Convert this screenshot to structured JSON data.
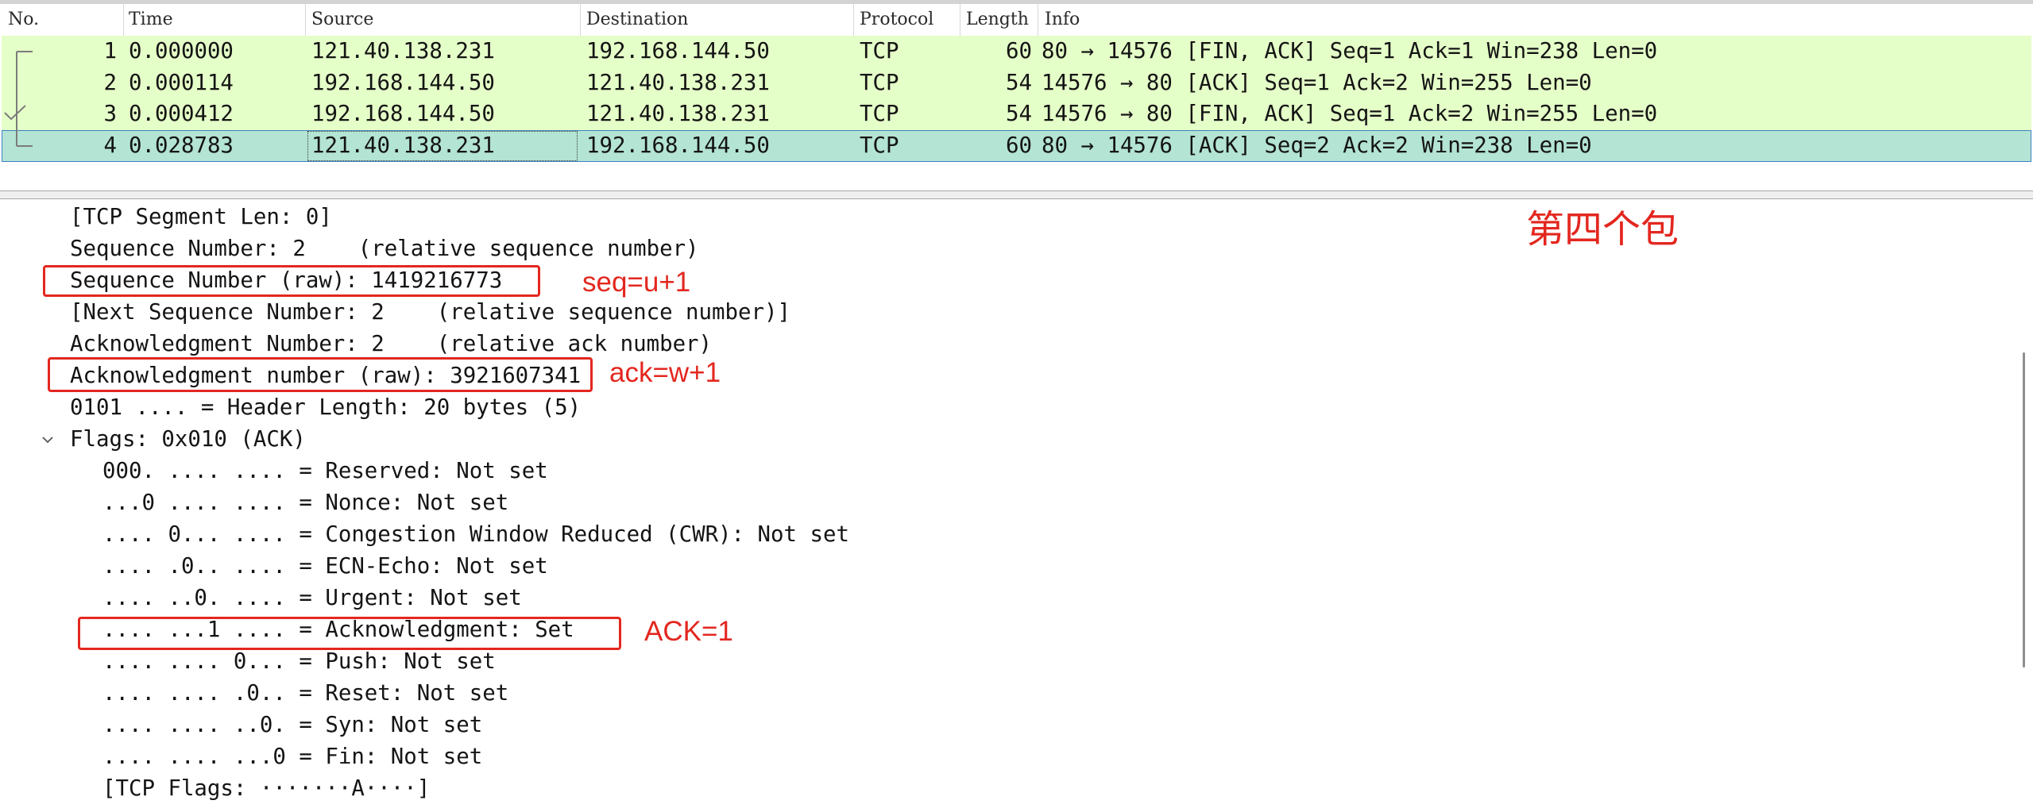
{
  "packet_list": {
    "columns": {
      "no": "No.",
      "time": "Time",
      "source": "Source",
      "destination": "Destination",
      "protocol": "Protocol",
      "length": "Length",
      "info": "Info"
    },
    "rows": [
      {
        "no": "1",
        "time": "0.000000",
        "source": "121.40.138.231",
        "destination": "192.168.144.50",
        "protocol": "TCP",
        "length": "60",
        "info": "80 → 14576 [FIN, ACK] Seq=1 Ack=1 Win=238 Len=0",
        "selected": false
      },
      {
        "no": "2",
        "time": "0.000114",
        "source": "192.168.144.50",
        "destination": "121.40.138.231",
        "protocol": "TCP",
        "length": "54",
        "info": "14576 → 80 [ACK] Seq=1 Ack=2 Win=255 Len=0",
        "selected": false
      },
      {
        "no": "3",
        "time": "0.000412",
        "source": "192.168.144.50",
        "destination": "121.40.138.231",
        "protocol": "TCP",
        "length": "54",
        "info": "14576 → 80 [FIN, ACK] Seq=1 Ack=2 Win=255 Len=0",
        "selected": false
      },
      {
        "no": "4",
        "time": "0.028783",
        "source": "121.40.138.231",
        "destination": "192.168.144.50",
        "protocol": "TCP",
        "length": "60",
        "info": "80 → 14576 [ACK] Seq=2 Ack=2 Win=238 Len=0",
        "selected": true
      }
    ]
  },
  "packet_details": {
    "lines": [
      "[TCP Segment Len: 0]",
      "Sequence Number: 2    (relative sequence number)",
      "Sequence Number (raw): 1419216773",
      "[Next Sequence Number: 2    (relative sequence number)]",
      "Acknowledgment Number: 2    (relative ack number)",
      "Acknowledgment number (raw): 3921607341",
      "0101 .... = Header Length: 20 bytes (5)",
      "Flags: 0x010 (ACK)",
      "000. .... .... = Reserved: Not set",
      "...0 .... .... = Nonce: Not set",
      ".... 0... .... = Congestion Window Reduced (CWR): Not set",
      ".... .0.. .... = ECN-Echo: Not set",
      ".... ..0. .... = Urgent: Not set",
      ".... ...1 .... = Acknowledgment: Set",
      ".... .... 0... = Push: Not set",
      ".... .... .0.. = Reset: Not set",
      ".... .... ..0. = Syn: Not set",
      ".... .... ...0 = Fin: Not set",
      "[TCP Flags: ·······A····]"
    ]
  },
  "annotations": {
    "title_note": "第四个包",
    "seq_note": "seq=u+1",
    "ack_note": "ack=w+1",
    "ack_flag_note": "ACK=1"
  },
  "icons": {
    "related_packets": "related-packets-indicator-icon",
    "flags_toggle": "chevron-down-icon"
  },
  "colors": {
    "row_background": "#e5ffc8",
    "selected_background": "#b4e4d3",
    "selected_border": "#3b82c4",
    "annotation": "#e3271f"
  }
}
